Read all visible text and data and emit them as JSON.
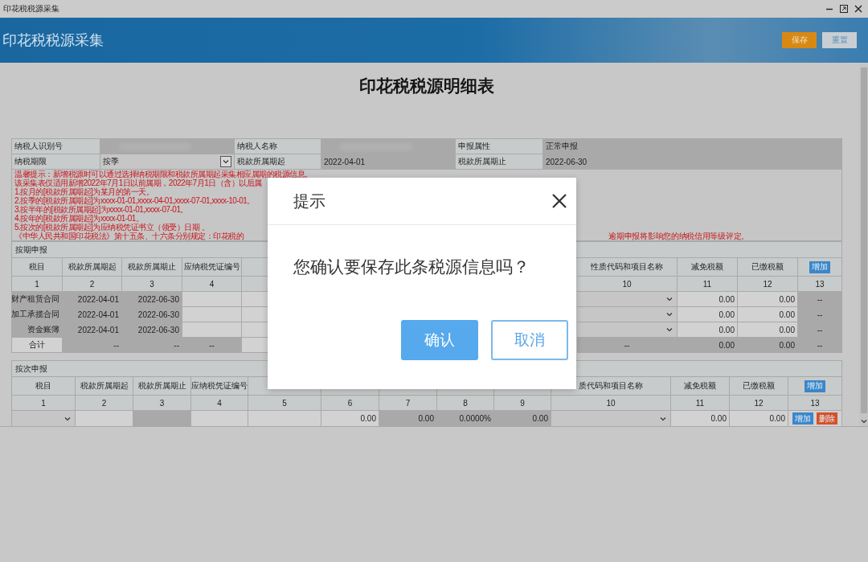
{
  "window": {
    "title": "印花税税源采集"
  },
  "header": {
    "title": "印花税税源采集",
    "buttons": [
      {
        "label": "保存",
        "kind": "primary"
      },
      {
        "label": "重置",
        "kind": "secondary"
      }
    ]
  },
  "page_title": "印花税税源明细表",
  "info": {
    "rows": [
      [
        {
          "kind": "label",
          "text": "纳税人识别号"
        },
        {
          "kind": "redacted"
        },
        {
          "kind": "label",
          "text": "纳税人名称"
        },
        {
          "kind": "redacted"
        },
        {
          "kind": "label",
          "text": "申报属性"
        },
        {
          "kind": "value",
          "text": "正常申报"
        }
      ],
      [
        {
          "kind": "label",
          "text": "纳税期限"
        },
        {
          "kind": "select",
          "text": "按季"
        },
        {
          "kind": "label",
          "text": "税款所属期起"
        },
        {
          "kind": "value",
          "text": "2022-04-01"
        },
        {
          "kind": "label",
          "text": "税款所属期止"
        },
        {
          "kind": "value",
          "text": "2022-06-30"
        }
      ]
    ]
  },
  "notice": {
    "lines": [
      "温馨提示：新增税源时可以通过选择纳税期限和税款所属期起采集相应属期的税源信息。",
      "该采集表仅适用新增2022年7月1日以前属期，2022年7月1日（含）以后属",
      "1.按月的[税款所属期起]为某月的第一天。",
      "2.按季的[税款所属期起]为xxxx-01-01,xxxx-04-01,xxxx-07-01,xxxx-10-01。",
      "3.按半年的[税款所属期起]为xxxx-01-01,xxxx-07-01。",
      "4.按年的[税款所属期起]为xxxx-01-01。",
      "5.按次的[税款所属期起]为应纳税凭证书立（领受）日期 。",
      "《中华人民共和国印花税法》第十五条、十六条分别规定：印花税的"
    ],
    "tail": "逾期申报将影响您的纳税信用等级评定。"
  },
  "periodic": {
    "title": "按期申报",
    "columns": [
      {
        "label": "税目",
        "number": "1"
      },
      {
        "label": "税款所属期起",
        "number": "2"
      },
      {
        "label": "税款所属期止",
        "number": "3"
      },
      {
        "label": "应纳税凭证编号",
        "number": "4"
      },
      {
        "label": "性质代码和项目名称",
        "number": "10"
      },
      {
        "label": "减免税额",
        "number": "11"
      },
      {
        "label": "已缴税额",
        "number": "12"
      },
      {
        "number": "13",
        "button": "增加"
      }
    ],
    "rows": [
      {
        "cells": [
          {
            "text": "财产租赁合同",
            "readonly": true
          },
          {
            "text": "2022-04-01",
            "readonly": true
          },
          {
            "text": "2022-06-30",
            "readonly": true
          },
          {
            "readonly": false
          },
          {
            "kind": "select"
          },
          {
            "text": "0.00",
            "readonly": false
          },
          {
            "text": "0.00",
            "readonly": false
          },
          {
            "text": "--",
            "readonly": true
          }
        ]
      },
      {
        "cells": [
          {
            "text": "加工承揽合同",
            "readonly": true
          },
          {
            "text": "2022-04-01",
            "readonly": true
          },
          {
            "text": "2022-06-30",
            "readonly": true
          },
          {
            "readonly": false
          },
          {
            "kind": "select"
          },
          {
            "text": "0.00",
            "readonly": false
          },
          {
            "text": "0.00",
            "readonly": false
          },
          {
            "text": "--",
            "readonly": true
          }
        ]
      },
      {
        "cells": [
          {
            "text": "资金账簿",
            "readonly": true
          },
          {
            "text": "2022-04-01",
            "readonly": true
          },
          {
            "text": "2022-06-30",
            "readonly": true
          },
          {
            "readonly": false
          },
          {
            "kind": "select"
          },
          {
            "text": "0.00",
            "readonly": false
          },
          {
            "text": "0.00",
            "readonly": false
          },
          {
            "text": "--",
            "readonly": true
          }
        ]
      },
      {
        "cells": [
          {
            "text": "合计",
            "readonly": false
          },
          {
            "text": "--",
            "readonly": true
          },
          {
            "text": "--",
            "readonly": true
          },
          {
            "text": "--",
            "readonly": true
          },
          {
            "text": "--",
            "readonly": true
          },
          {
            "text": "0.00",
            "readonly": true
          },
          {
            "text": "0.00",
            "readonly": true
          },
          {
            "text": "--",
            "readonly": true
          }
        ]
      }
    ]
  },
  "per_use": {
    "title": "按次申报",
    "columns": [
      {
        "label": "税目",
        "number": "1"
      },
      {
        "label": "税款所属期起",
        "number": "2"
      },
      {
        "label": "税款所属期止",
        "number": "3"
      },
      {
        "label": "应纳税凭证编号",
        "number": "4"
      },
      {
        "number": "5"
      },
      {
        "number": "6"
      },
      {
        "number": "7"
      },
      {
        "number": "8"
      },
      {
        "number": "9"
      },
      {
        "label": "质代码和项目名称",
        "number": "10"
      },
      {
        "label": "减免税额",
        "number": "11"
      },
      {
        "label": "已缴税额",
        "number": "12"
      },
      {
        "number": "13",
        "button": "增加"
      }
    ],
    "rows": [
      {
        "cells": [
          {
            "kind": "select"
          },
          {
            "readonly": false
          },
          {
            "readonly": true
          },
          {
            "readonly": false
          },
          {
            "readonly": false
          },
          {
            "text": "0.00",
            "readonly": false
          },
          {
            "text": "0.00",
            "readonly": true
          },
          {
            "text": "0.0000%",
            "readonly": true
          },
          {
            "text": "0.00",
            "readonly": true
          },
          {
            "kind": "select"
          },
          {
            "text": "0.00",
            "readonly": false
          },
          {
            "text": "0.00",
            "readonly": false
          },
          {
            "kind": "buttons",
            "buttons": [
              {
                "label": "增加",
                "kind": "add"
              },
              {
                "label": "删除",
                "kind": "delete"
              }
            ]
          }
        ]
      }
    ]
  },
  "dialog": {
    "title": "提示",
    "message": "您确认要保存此条税源信息吗？",
    "buttons": [
      {
        "label": "确认",
        "kind": "primary"
      },
      {
        "label": "取消",
        "kind": "secondary"
      }
    ]
  }
}
